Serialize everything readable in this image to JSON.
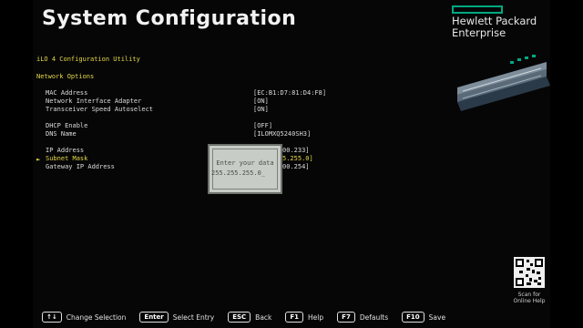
{
  "header": {
    "title": "System Configuration",
    "logo_line1": "Hewlett Packard",
    "logo_line2": "Enterprise"
  },
  "utility": {
    "name": "iLO 4 Configuration Utility",
    "section": "Network Options"
  },
  "settings": [
    {
      "label": "MAC Address",
      "value": "[EC:B1:D7:81:D4:F8]"
    },
    {
      "label": "Network Interface Adapter",
      "value": "[ON]"
    },
    {
      "label": "Transceiver Speed Autoselect",
      "value": "[ON]"
    },
    {
      "label": "DHCP Enable",
      "value": "[OFF]"
    },
    {
      "label": "DNS Name",
      "value": "[ILOMXQ5240SH3]"
    },
    {
      "label": "IP Address",
      "value": "00.233]"
    },
    {
      "label": "Subnet Mask",
      "value": "5.255.0]"
    },
    {
      "label": "Gateway IP Address",
      "value": "00.254]"
    }
  ],
  "selected_marker": "►",
  "dialog": {
    "prompt": "Enter your data",
    "value": "255.255.255.0_"
  },
  "qr": {
    "caption_line1": "Scan for",
    "caption_line2": "Online Help"
  },
  "footer": [
    {
      "key": "↑↓",
      "label": "Change Selection"
    },
    {
      "key": "Enter",
      "label": "Select Entry"
    },
    {
      "key": "ESC",
      "label": "Back"
    },
    {
      "key": "F1",
      "label": "Help"
    },
    {
      "key": "F7",
      "label": "Defaults"
    },
    {
      "key": "F10",
      "label": "Save"
    }
  ]
}
